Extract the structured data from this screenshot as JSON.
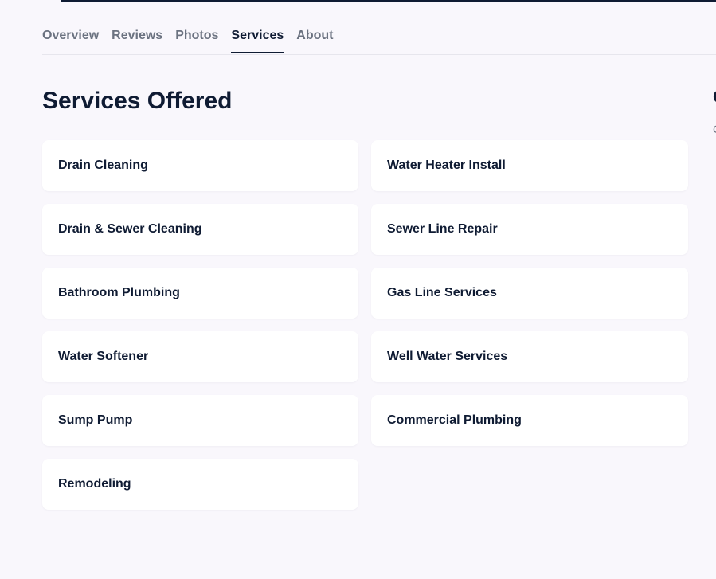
{
  "tabs": [
    {
      "label": "Overview"
    },
    {
      "label": "Reviews"
    },
    {
      "label": "Photos"
    },
    {
      "label": "Services"
    },
    {
      "label": "About"
    }
  ],
  "active_tab": "Services",
  "page_title": "Services Offered",
  "side_panel": {
    "heading_fragment": "C",
    "text_fragment": "C"
  },
  "services": [
    {
      "label": "Drain Cleaning"
    },
    {
      "label": "Water Heater Install"
    },
    {
      "label": "Drain & Sewer Cleaning"
    },
    {
      "label": "Sewer Line Repair"
    },
    {
      "label": "Bathroom Plumbing"
    },
    {
      "label": "Gas Line Services"
    },
    {
      "label": "Water Softener"
    },
    {
      "label": "Well Water Services"
    },
    {
      "label": "Sump Pump"
    },
    {
      "label": "Commercial Plumbing"
    },
    {
      "label": "Remodeling"
    }
  ],
  "colors": {
    "background": "#f9f7fc",
    "text_primary": "#0f1b33",
    "text_muted": "#6b7280",
    "card": "#ffffff",
    "divider": "#e7e6ed"
  }
}
